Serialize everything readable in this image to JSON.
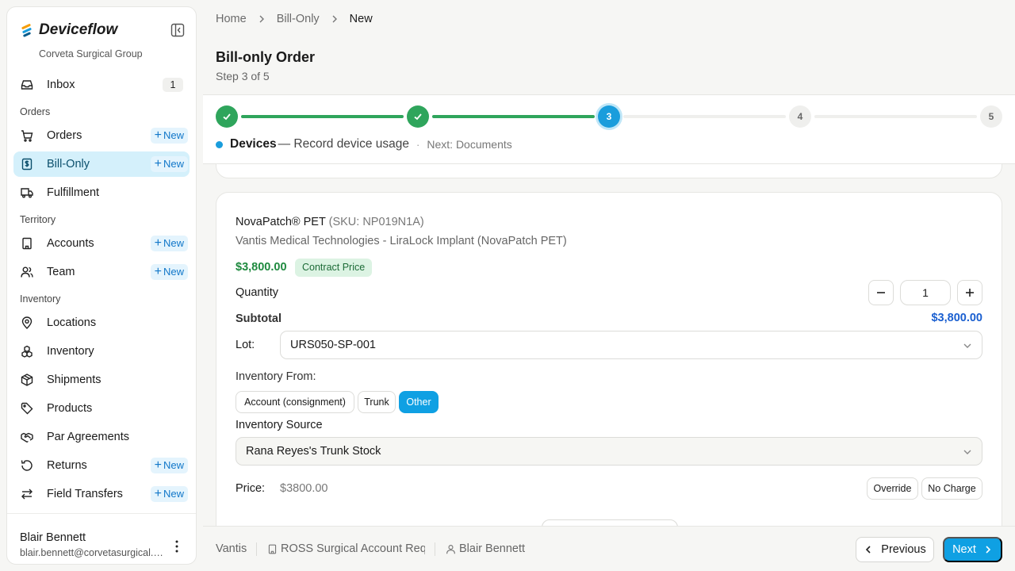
{
  "brand": {
    "name": "Deviceflow",
    "org": "Corveta Surgical Group",
    "accent": "#0fa0e3"
  },
  "nav": {
    "inbox": {
      "label": "Inbox",
      "count": "1"
    },
    "sections": {
      "orders": "Orders",
      "territory": "Territory",
      "inventory": "Inventory"
    },
    "new_label": "New",
    "items": {
      "orders": "Orders",
      "bill_only": "Bill-Only",
      "fulfillment": "Fulfillment",
      "accounts": "Accounts",
      "team": "Team",
      "locations": "Locations",
      "inventory": "Inventory",
      "shipments": "Shipments",
      "products": "Products",
      "par_agreements": "Par Agreements",
      "returns": "Returns",
      "field_transfers": "Field Transfers"
    }
  },
  "user": {
    "name": "Blair Bennett",
    "email": "blair.bennett@corvetasurgical.com"
  },
  "breadcrumb": [
    "Home",
    "Bill-Only",
    "New"
  ],
  "page": {
    "title": "Bill-only Order",
    "step": "Step 3 of 5"
  },
  "stepper": {
    "steps": [
      "1",
      "2",
      "3",
      "4",
      "5"
    ],
    "current_name": "Devices",
    "current_desc": "— Record device usage",
    "next": "Next: Documents"
  },
  "product": {
    "name": "NovaPatch® PET",
    "sku": "(SKU: NP019N1A)",
    "subtitle": "Vantis Medical Technologies - LiraLock Implant (NovaPatch PET)",
    "price": "$3,800.00",
    "price_badge": "Contract Price",
    "quantity_label": "Quantity",
    "quantity": "1",
    "subtotal_label": "Subtotal",
    "subtotal": "$3,800.00",
    "lot_label": "Lot:",
    "lot": "URS050-SP-001",
    "inventory_from_label": "Inventory From:",
    "inventory_from_options": [
      "Account (consignment)",
      "Trunk",
      "Other"
    ],
    "inventory_from_selected": "Other",
    "inventory_source_label": "Inventory Source",
    "inventory_source": "Rana Reyes's Trunk Stock",
    "price_label": "Price:",
    "price_value": "$3800.00",
    "override_label": "Override",
    "no_charge_label": "No Charge"
  },
  "footer": {
    "manufacturer": "Vantis",
    "account": "ROSS Surgical Account Request",
    "rep": "Blair Bennett",
    "previous_label": "Previous",
    "next_label": "Next"
  }
}
